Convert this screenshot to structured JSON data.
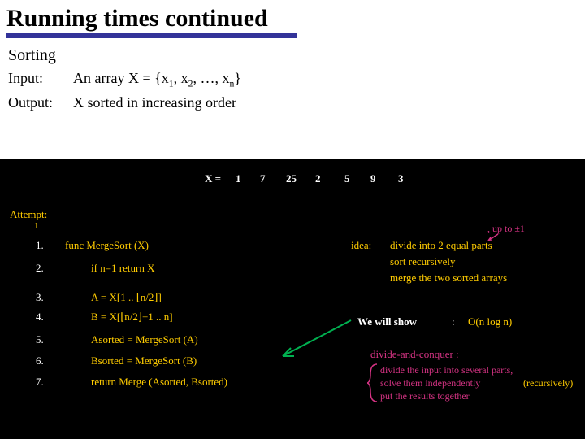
{
  "title": "Running times continued",
  "section": "Sorting",
  "input_label": "Input:",
  "input_text": "An array X = {x",
  "input_sub1": "1",
  "input_mid1": ", x",
  "input_sub2": "2",
  "input_mid2": ", …, x",
  "input_subn": "n",
  "input_end": "}",
  "output_label": "Output:",
  "output_text": "X sorted in increasing order",
  "board": {
    "x_eq": "X =",
    "arr": [
      "1",
      "7",
      "25",
      "2",
      "5",
      "9",
      "3"
    ],
    "attempt": "Attempt:",
    "attempt_sub": "1",
    "steps_num": [
      "1.",
      "2.",
      "3.",
      "4.",
      "5.",
      "6.",
      "7."
    ],
    "step1": "func MergeSort (X)",
    "step2": "if n=1 return X",
    "step3": "A = X[1 .. ⌊n/2⌋]",
    "step4": "B = X[⌊n/2⌋+1 .. n]",
    "step5": "Asorted = MergeSort (A)",
    "step6": "Bsorted = MergeSort (B)",
    "step7": "return Merge (Asorted, Bsorted)",
    "idea_lbl": "idea:",
    "idea_pre": ", up to ±1",
    "idea1": "divide into 2 equal parts",
    "idea2": "sort recursively",
    "idea3": "merge the two sorted arrays",
    "show": "We will show",
    "colon": ":",
    "bigO": "O(n log n)",
    "dac_title": "divide-and-conquer :",
    "dac1": "divide the input into several parts,",
    "dac2": "solve them independently",
    "dac2_tail": "(recursively)",
    "dac3": "put the results together"
  }
}
